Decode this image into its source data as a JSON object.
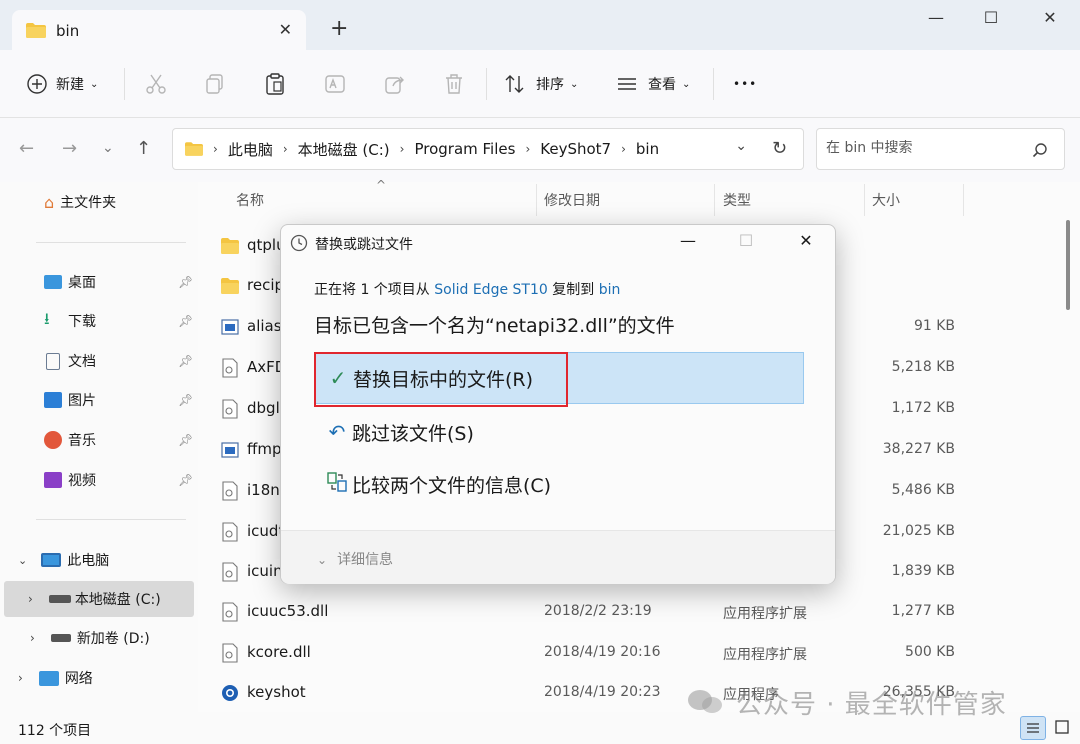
{
  "tab": {
    "title": "bin",
    "close": "✕",
    "new": "+"
  },
  "window": {
    "minimize": "—",
    "maximize": "☐",
    "close": "✕"
  },
  "toolbar": {
    "new_label": "新建",
    "sort_label": "排序",
    "view_label": "查看",
    "more": "•••"
  },
  "breadcrumb": [
    "此电脑",
    "本地磁盘 (C:)",
    "Program Files",
    "KeyShot7",
    "bin"
  ],
  "search": {
    "placeholder": "在 bin 中搜索"
  },
  "sidebar": {
    "home": "主文件夹",
    "quick": [
      {
        "label": "桌面",
        "icon": "desktop-icon"
      },
      {
        "label": "下载",
        "icon": "download-icon"
      },
      {
        "label": "文档",
        "icon": "document-icon"
      },
      {
        "label": "图片",
        "icon": "pictures-icon"
      },
      {
        "label": "音乐",
        "icon": "music-icon"
      },
      {
        "label": "视频",
        "icon": "video-icon"
      }
    ],
    "this_pc": "此电脑",
    "drive_c": "本地磁盘 (C:)",
    "drive_d": "新加卷 (D:)",
    "network": "网络"
  },
  "columns": {
    "name": "名称",
    "date": "修改日期",
    "type": "类型",
    "size": "大小"
  },
  "files": [
    {
      "name": "qtplu",
      "date": "",
      "type": "",
      "size": "",
      "icon": "folder"
    },
    {
      "name": "recip",
      "date": "",
      "type": "",
      "size": "",
      "icon": "folder"
    },
    {
      "name": "alias_",
      "date": "",
      "type": "",
      "size": "91 KB",
      "icon": "app"
    },
    {
      "name": "AxFD",
      "date": "",
      "type": "",
      "size": "5,218 KB",
      "icon": "dll"
    },
    {
      "name": "dbgl",
      "date": "",
      "type": "",
      "size": "1,172 KB",
      "icon": "dll"
    },
    {
      "name": "ffmp",
      "date": "",
      "type": "",
      "size": "38,227 KB",
      "icon": "app"
    },
    {
      "name": "i18n.",
      "date": "",
      "type": "",
      "size": "5,486 KB",
      "icon": "dll"
    },
    {
      "name": "icudt",
      "date": "",
      "type": "",
      "size": "21,025 KB",
      "icon": "dll"
    },
    {
      "name": "icuin",
      "date": "",
      "type": "",
      "size": "1,839 KB",
      "icon": "dll"
    },
    {
      "name": "icuuc53.dll",
      "date": "2018/2/2 23:19",
      "type": "应用程序扩展",
      "size": "1,277 KB",
      "icon": "dll"
    },
    {
      "name": "kcore.dll",
      "date": "2018/4/19 20:16",
      "type": "应用程序扩展",
      "size": "500 KB",
      "icon": "dll"
    },
    {
      "name": "keyshot",
      "date": "2018/4/19 20:23",
      "type": "应用程序",
      "size": "26,355 KB",
      "icon": "keyshot"
    }
  ],
  "status": {
    "count": "112 个项目"
  },
  "watermark": "公众号 · 最全软件管家",
  "dialog": {
    "title": "替换或跳过文件",
    "line1_prefix": "正在将 1 个项目从 ",
    "line1_source": "Solid Edge ST10",
    "line1_mid": " 复制到 ",
    "line1_dest": "bin",
    "line2": "目标已包含一个名为“netapi32.dll”的文件",
    "option_replace": "替换目标中的文件(R)",
    "option_skip": "跳过该文件(S)",
    "option_compare": "比较两个文件的信息(C)",
    "details": "详细信息",
    "minimize": "—",
    "maximize": "☐",
    "close": "✕"
  },
  "colors": {
    "accent": "#1d6fb4",
    "highlight": "#cce4f7",
    "redbox": "#e0262e",
    "folder": "#f4c542"
  }
}
